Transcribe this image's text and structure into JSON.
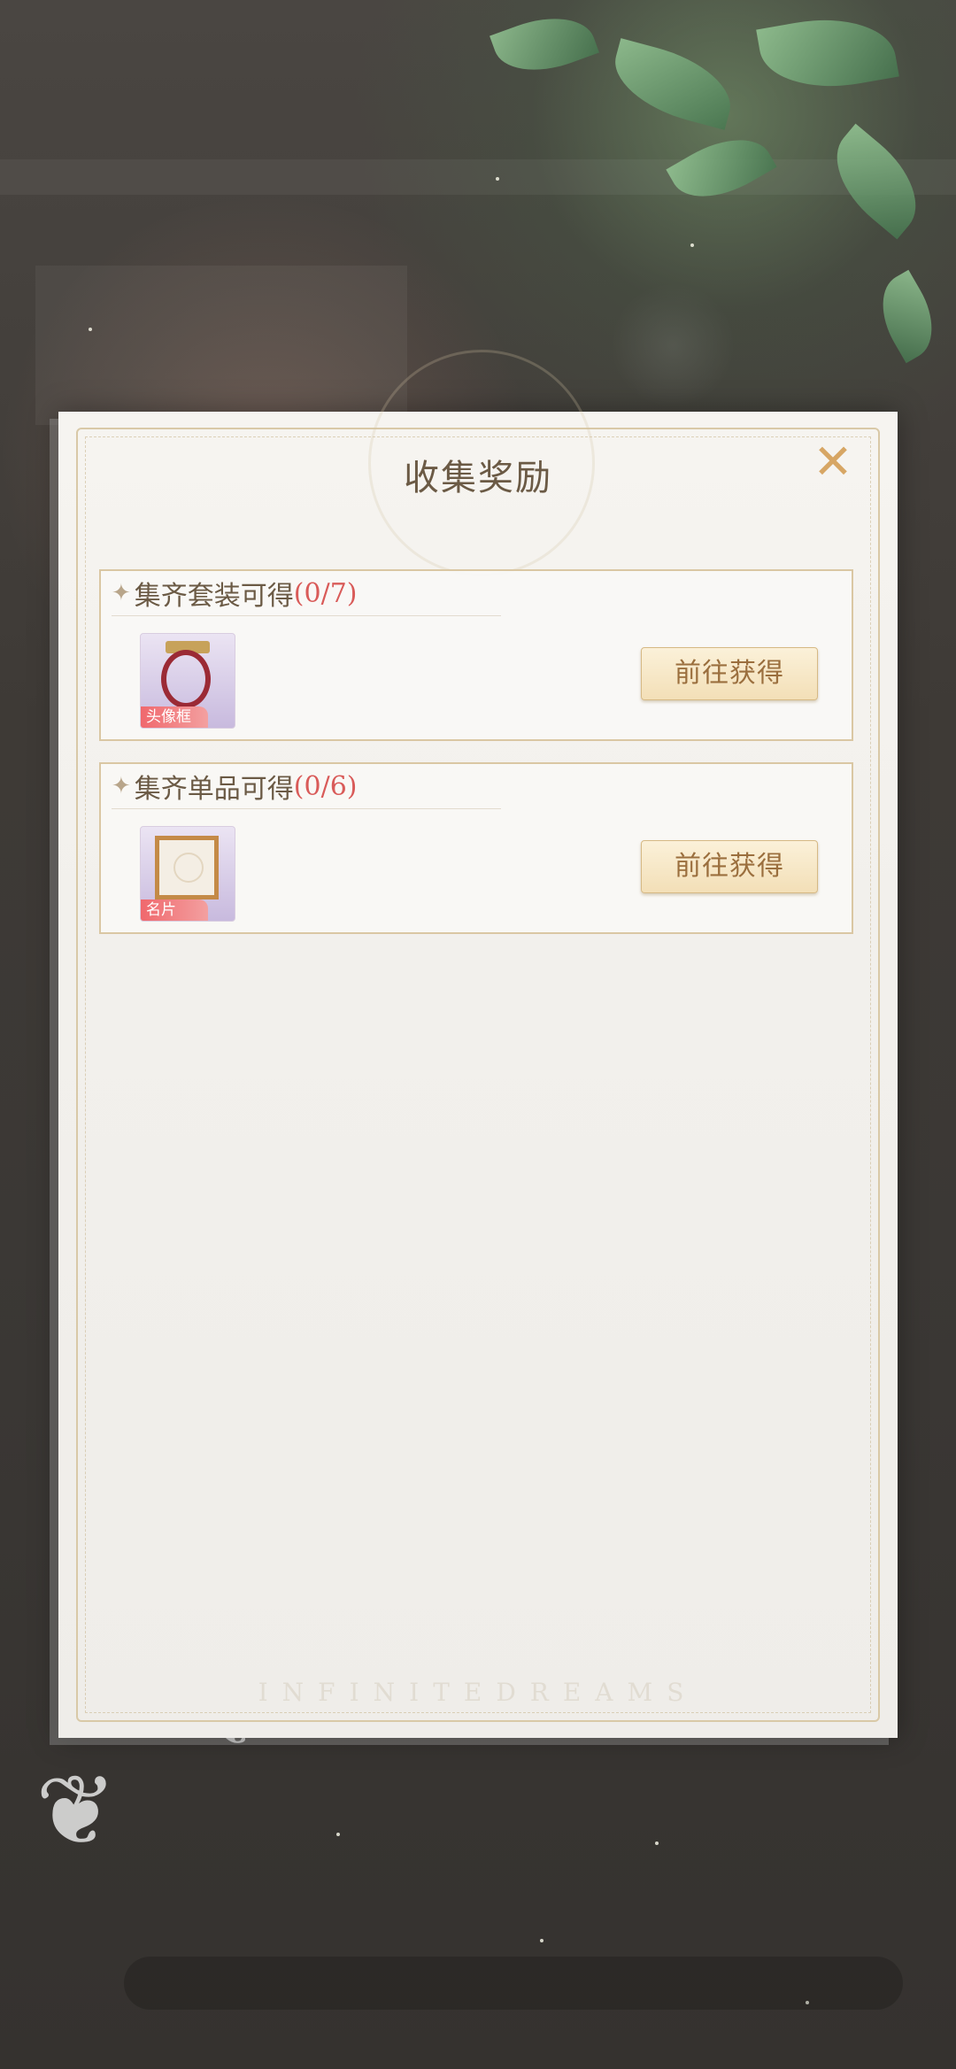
{
  "modal": {
    "title": "收集奖励",
    "close_icon": "close-x-icon",
    "watermark": "INFINITEDREAMS"
  },
  "sections": [
    {
      "title": "集齐套装可得",
      "count": "(0/7)",
      "reward_tag": "头像框",
      "reward_icon": "avatar-frame-icon",
      "button_label": "前往获得"
    },
    {
      "title": "集齐单品可得",
      "count": "(0/6)",
      "reward_tag": "名片",
      "reward_icon": "name-card-icon",
      "button_label": "前往获得"
    }
  ],
  "colors": {
    "title": "#6b5a45",
    "count": "#d95b59",
    "button_text": "#9b6f3e",
    "close": "#d7a664",
    "tag": "#f0686d"
  }
}
